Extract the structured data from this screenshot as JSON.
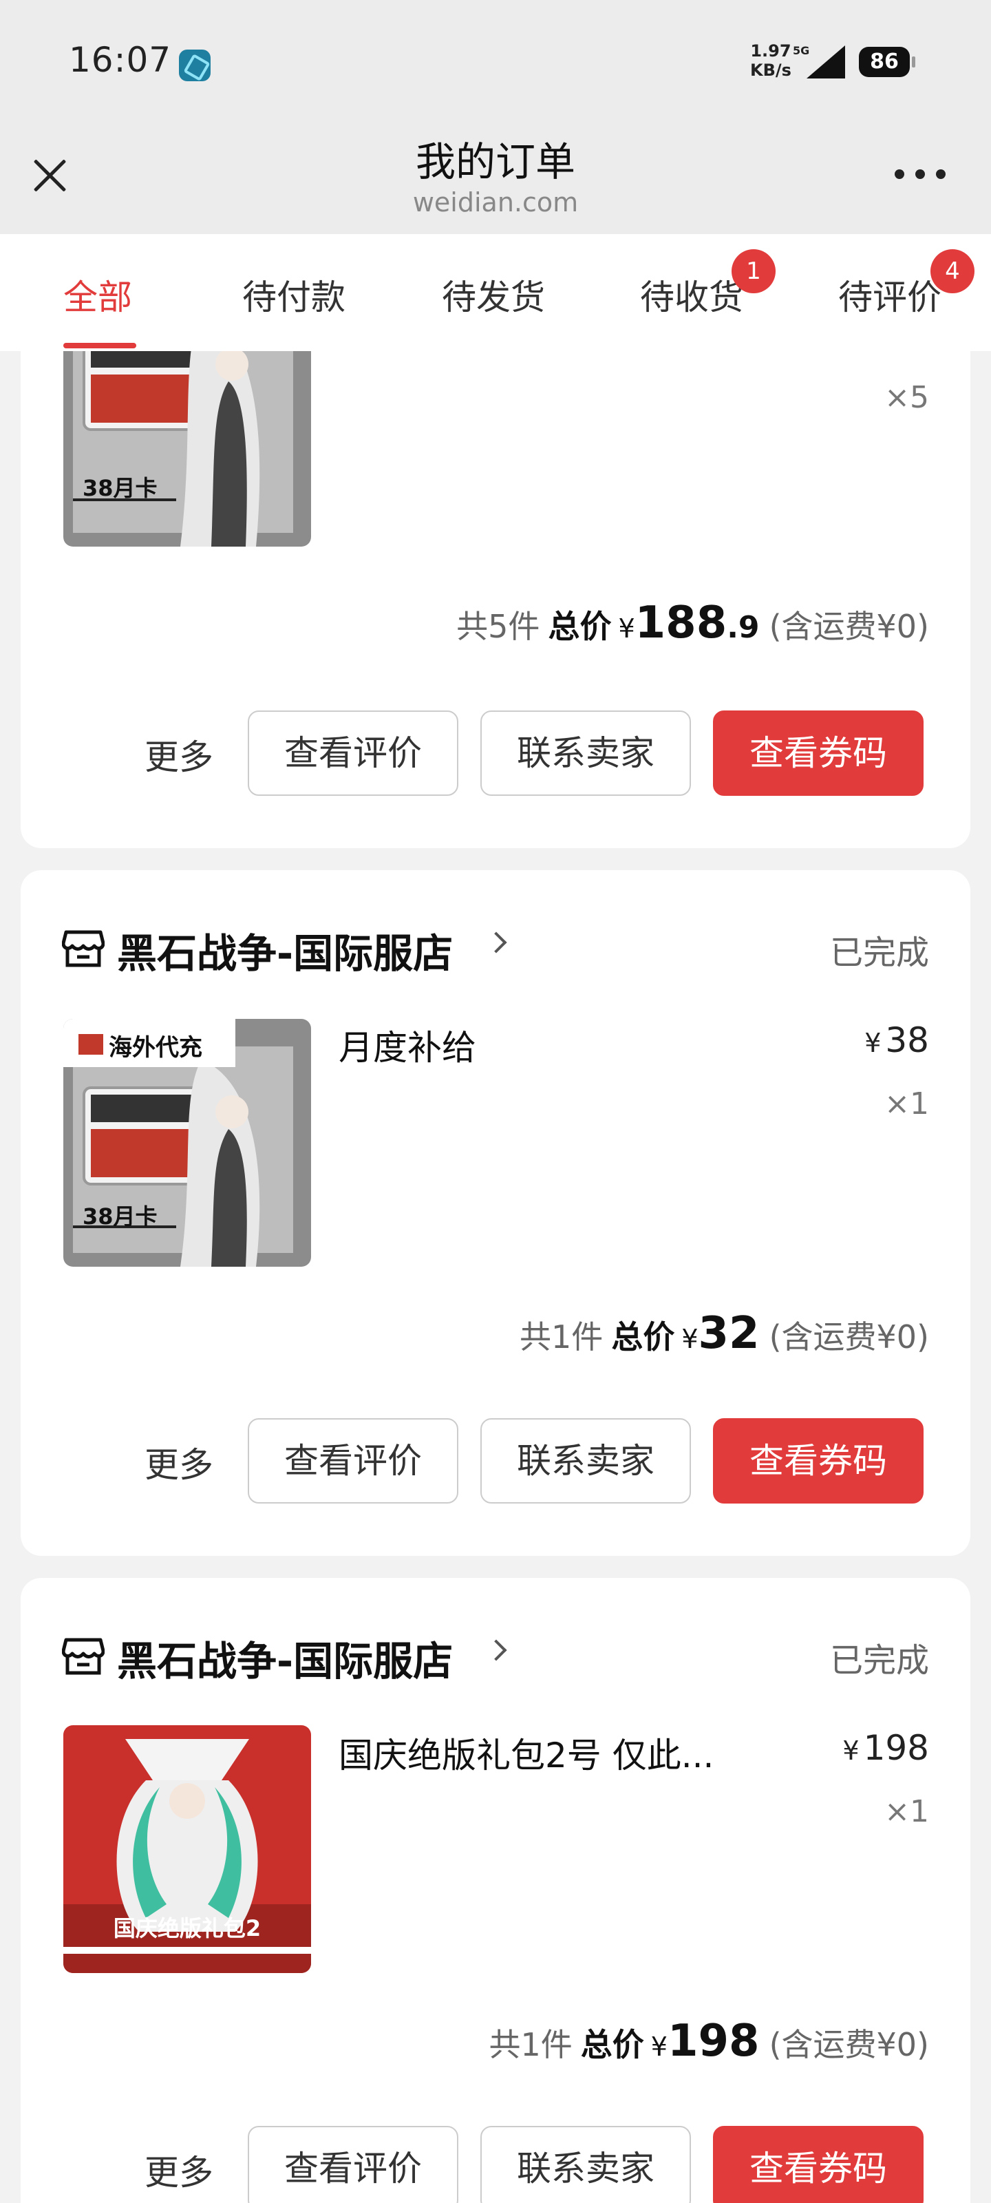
{
  "status_bar": {
    "time": "16:07",
    "net_speed": "1.97",
    "net_unit": "KB/s",
    "net_type": "5G",
    "battery": "86"
  },
  "header": {
    "title": "我的订单",
    "subtitle": "weidian.com"
  },
  "tabs": [
    {
      "label": "全部",
      "active": true
    },
    {
      "label": "待付款"
    },
    {
      "label": "待发货"
    },
    {
      "label": "待收货",
      "badge": "1"
    },
    {
      "label": "待评价",
      "badge": "4"
    }
  ],
  "orders": [
    {
      "shop_name": "",
      "status": "",
      "product_name": "",
      "unit_price": "",
      "qty": "×5",
      "thumb_label": "38月卡",
      "total_count": "共5件",
      "total_label": "总价",
      "currency": "¥",
      "total_int": "188",
      "total_dec": ".9",
      "shipping": "(含运费¥0)",
      "actions": {
        "more": "更多",
        "review": "查看评价",
        "contact": "联系卖家",
        "coupon": "查看券码"
      }
    },
    {
      "shop_name": "黑石战争-国际服店",
      "status": "已完成",
      "product_name": "月度补给",
      "unit_price": "38",
      "qty": "×1",
      "thumb_label": "38月卡",
      "thumb_tag": "海外代充",
      "total_count": "共1件",
      "total_label": "总价",
      "currency": "¥",
      "total_int": "32",
      "total_dec": "",
      "shipping": "(含运费¥0)",
      "actions": {
        "more": "更多",
        "review": "查看评价",
        "contact": "联系卖家",
        "coupon": "查看券码"
      }
    },
    {
      "shop_name": "黑石战争-国际服店",
      "status": "已完成",
      "product_name": "国庆绝版礼包2号 仅此...",
      "unit_price": "198",
      "qty": "×1",
      "thumb_label": "国庆绝版礼包2",
      "total_count": "共1件",
      "total_label": "总价",
      "currency": "¥",
      "total_int": "198",
      "total_dec": "",
      "shipping": "(含运费¥0)",
      "actions": {
        "more": "更多",
        "review": "查看评价",
        "contact": "联系卖家",
        "coupon": "查看券码"
      }
    }
  ],
  "colors": {
    "accent": "#e23b3b",
    "page_bg": "#f2f2f2",
    "card_bg": "#ffffff"
  }
}
